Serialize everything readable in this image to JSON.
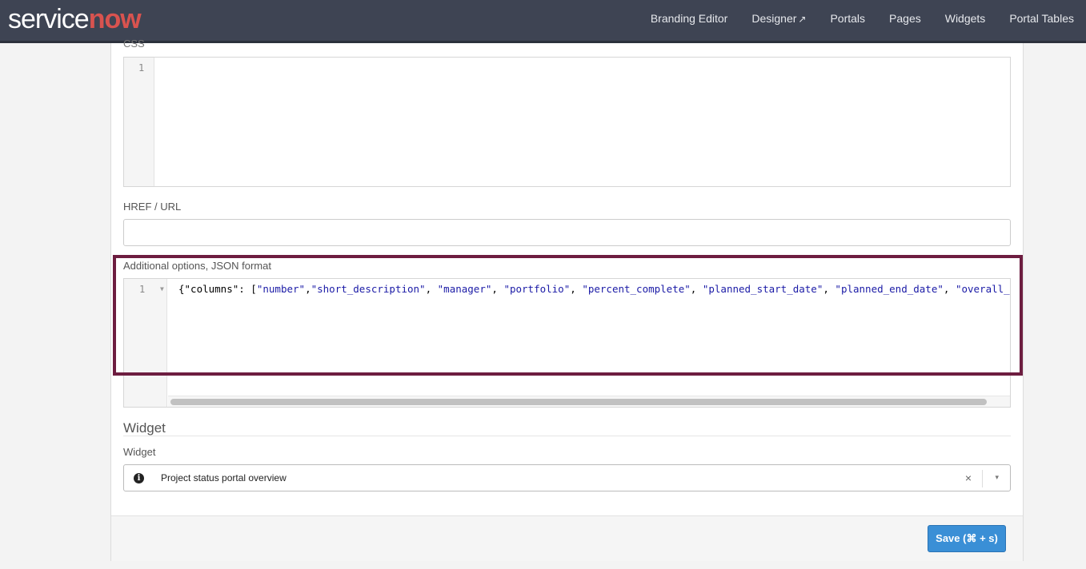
{
  "brand": {
    "logo_service": "service",
    "logo_now": "now"
  },
  "nav": {
    "items": [
      "Branding Editor",
      "Designer",
      "Portals",
      "Pages",
      "Widgets",
      "Portal Tables"
    ],
    "external_icon": "external-link-icon"
  },
  "css_field": {
    "label": "CSS",
    "line_number": "1"
  },
  "href_field": {
    "label": "HREF / URL",
    "value": ""
  },
  "options_field": {
    "label": "Additional options, JSON format",
    "line_number": "1",
    "code_prefix": "{\"columns\": [",
    "code_strings": [
      "\"number\"",
      "\"short_description\"",
      "\"manager\"",
      "\"portfolio\"",
      "\"percent_complete\"",
      "\"planned_start_date\"",
      "\"planned_end_date\"",
      "\"overall_status"
    ]
  },
  "widget_section": {
    "title": "Widget",
    "field_label": "Widget",
    "selected": "Project status portal overview",
    "clear_symbol": "×",
    "caret_symbol": "▾"
  },
  "footer": {
    "save_label": "Save (⌘ + s)"
  },
  "colors": {
    "nav_bg": "#3e4453",
    "highlight": "#6d1d40",
    "save_btn": "#3a8fd6",
    "json_string": "#1a1aa6"
  }
}
